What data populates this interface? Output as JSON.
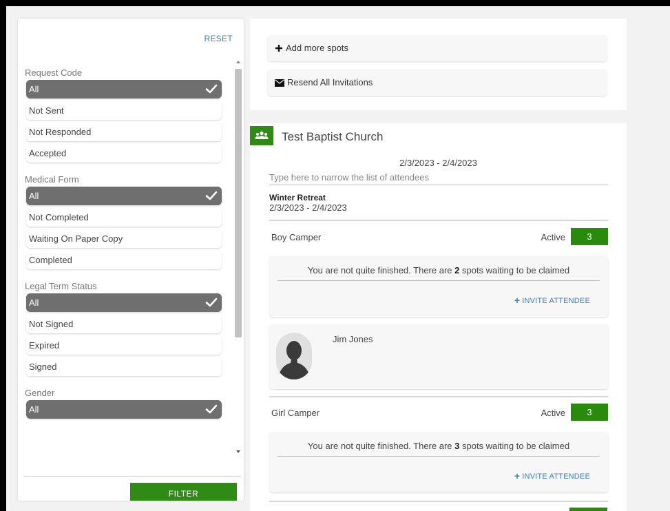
{
  "filters": {
    "reset_label": "RESET",
    "filter_label": "FILTER",
    "groups": [
      {
        "title": "Request Code",
        "options": [
          "All",
          "Not Sent",
          "Not Responded",
          "Accepted"
        ],
        "selected": 0
      },
      {
        "title": "Medical Form",
        "options": [
          "All",
          "Not Completed",
          "Waiting On Paper Copy",
          "Completed"
        ],
        "selected": 0
      },
      {
        "title": "Legal Term Status",
        "options": [
          "All",
          "Not Signed",
          "Expired",
          "Signed"
        ],
        "selected": 0
      },
      {
        "title": "Gender",
        "options": [
          "All"
        ],
        "selected": 0
      }
    ]
  },
  "actions": {
    "add_spots": "Add more spots",
    "resend": "Resend All Invitations"
  },
  "group": {
    "name": "Test Baptist Church",
    "date_range": "2/3/2023 - 2/4/2023",
    "search_placeholder": "Type here to narrow the list of attendees",
    "event_name": "Winter Retreat",
    "event_dates": "2/3/2023 - 2/4/2023",
    "categories": [
      {
        "name": "Boy Camper",
        "status": "Active",
        "count": "3",
        "notice_prefix": "You are not quite finished. There are ",
        "notice_count": "2",
        "notice_suffix": " spots waiting to be claimed",
        "invite_label": "INVITE ATTENDEE",
        "attendees": [
          "Jim Jones"
        ]
      },
      {
        "name": "Girl Camper",
        "status": "Active",
        "count": "3",
        "notice_prefix": "You are not quite finished. There are ",
        "notice_count": "3",
        "notice_suffix": " spots waiting to be claimed",
        "invite_label": "INVITE ATTENDEE",
        "attendees": []
      }
    ]
  },
  "colors": {
    "accent_green": "#2a8a0c",
    "link_blue": "#3a7fc4",
    "selected_gray": "#6f6f6f"
  }
}
